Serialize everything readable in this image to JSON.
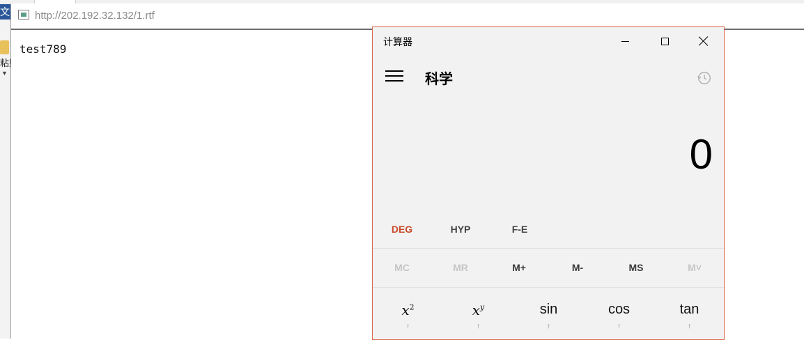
{
  "background_app": {
    "tab_label": "文件",
    "paste_label": "粘贴"
  },
  "browser": {
    "url": "http://202.192.32.132/1.rtf",
    "document_text": "test789"
  },
  "calculator": {
    "window_title": "计算器",
    "mode_title": "科学",
    "display_value": "0",
    "angle_buttons": [
      "DEG",
      "HYP",
      "F-E"
    ],
    "memory_buttons": [
      "MC",
      "MR",
      "M+",
      "M-",
      "MS",
      "M˅"
    ],
    "function_buttons": [
      {
        "base": "x",
        "sup": "2",
        "shift": "↑"
      },
      {
        "base": "x",
        "sup": "y",
        "shift": "↑"
      },
      {
        "label": "sin",
        "shift": "↑"
      },
      {
        "label": "cos",
        "shift": "↑"
      },
      {
        "label": "tan",
        "shift": "↑"
      }
    ],
    "accent_color": "#c94a2b",
    "border_color": "#da6a4b"
  }
}
